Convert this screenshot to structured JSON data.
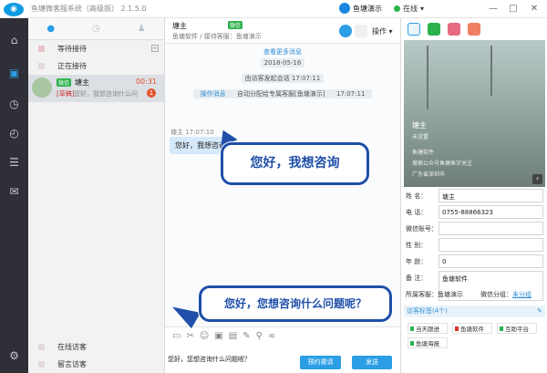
{
  "titlebar": {
    "app_title": "鱼塘微客服系统（高级版） 2.1.5.0",
    "user_name": "鱼塘演示",
    "status": "在线",
    "controls": [
      "▾",
      "—",
      "□",
      "✕"
    ]
  },
  "convlist": {
    "groups_top": [
      {
        "label": "等待接待"
      },
      {
        "label": "正在接待"
      }
    ],
    "conversation": {
      "tag": "微信",
      "name": "塘主",
      "time": "00:31",
      "draft_label": "[草稿]",
      "preview": "您好，我想咨询什么问题呢？",
      "unread": "1"
    },
    "groups_bottom": [
      {
        "label": "在线访客"
      },
      {
        "label": "留言访客"
      }
    ]
  },
  "chat": {
    "header": {
      "name": "塘主",
      "tag": "微信",
      "subtitle": "鱼塘软件 / 接待客服：鱼塘演示",
      "ops_label": "操作 ▾"
    },
    "system": {
      "load_more": "查看更多消息",
      "date": "2018-05-16",
      "start_line": "由访客发起会话 17:07:11",
      "op_label": "操作消息",
      "op_text": "自动分配给专属客服[鱼塘演示]",
      "op_time": "17:07:11"
    },
    "message": {
      "meta": "塘主 17:07:10",
      "text": "您好，我想咨询"
    },
    "callouts": {
      "c1": "您好，我想咨询",
      "c2": "您好，您想咨询什么问题呢？"
    },
    "input": {
      "typed": "您好，您想咨询什么问题呢？",
      "invite_label": "预约邀请",
      "send_label": "发送"
    }
  },
  "profile": {
    "photo_name": "塘主",
    "photo_lines": [
      "未设置",
      "鱼塘软件",
      "搜索公众号鱼塘鱼字关注",
      "广东省深圳市"
    ],
    "fields": [
      {
        "label": "姓    名：",
        "value": "塘主"
      },
      {
        "label": "电    话：",
        "value": "0755-88866323"
      },
      {
        "label": "微信账号：",
        "value": ""
      },
      {
        "label": "性    别：",
        "value": ""
      },
      {
        "label": "年    龄：",
        "value": "0"
      },
      {
        "label": "备    注：",
        "value": "鱼塘软件"
      }
    ],
    "belong_label": "所属客服：鱼塘演示",
    "wx_group_label": "微信分组：",
    "wx_group_value": "未分组",
    "tags_header": "访客标签(4个)",
    "tags": [
      {
        "label": "当天跟进",
        "color": "#2bb24c"
      },
      {
        "label": "鱼塘软件",
        "color": "#d93434"
      },
      {
        "label": "互助平台",
        "color": "#2bb24c"
      },
      {
        "label": "鱼塘海报",
        "color": "#2bb24c"
      }
    ]
  },
  "colors": {
    "accent": "#2b9ee6",
    "callout_border": "#1f4fa8",
    "nav_bg": "#2f2f37",
    "online": "#2bb24c",
    "alert": "#e0532c"
  }
}
